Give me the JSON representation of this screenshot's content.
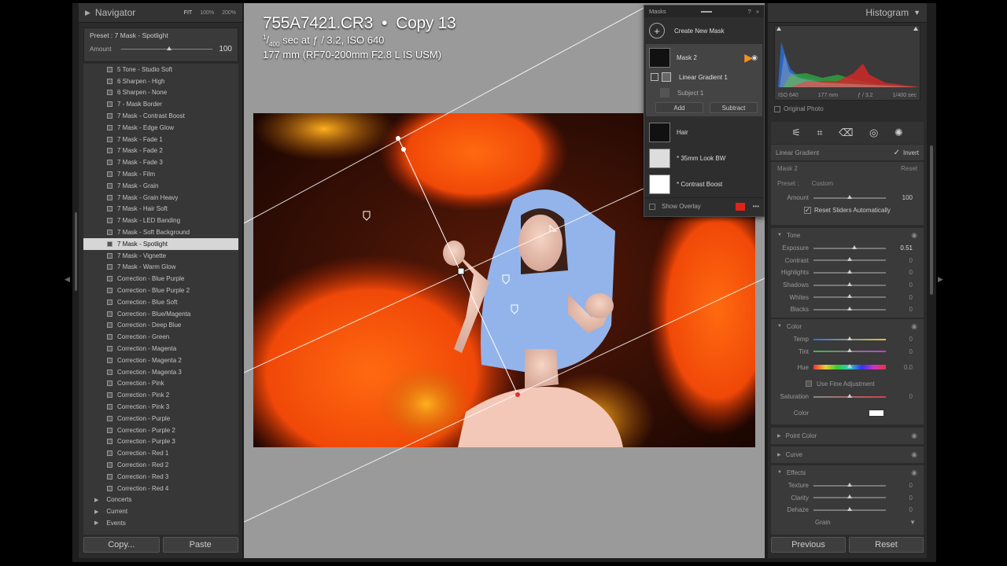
{
  "left": {
    "navigator_title": "Navigator",
    "nav_opts": [
      "FIT",
      "100%",
      "200%"
    ],
    "preset_label": "Preset : 7 Mask - Spotlight",
    "amount_label": "Amount",
    "amount_value": "100",
    "presets": [
      "5 Tone - Studio Soft",
      "6 Sharpen - High",
      "6 Sharpen - None",
      "7 - Mask Border",
      "7 Mask - Contrast Boost",
      "7 Mask - Edge Glow",
      "7 Mask - Fade 1",
      "7 Mask - Fade 2",
      "7 Mask - Fade 3",
      "7 Mask - Film",
      "7 Mask - Grain",
      "7 Mask - Grain Heavy",
      "7 Mask - Hair Soft",
      "7 Mask - LED Banding",
      "7 Mask - Soft Background",
      "7 Mask - Spotlight",
      "7 Mask - Vignette",
      "7 Mask - Warm Glow",
      "Correction - Blue Purple",
      "Correction - Blue Purple 2",
      "Correction - Blue Soft",
      "Correction - Blue/Magenta",
      "Correction - Deep Blue",
      "Correction - Green",
      "Correction - Magenta",
      "Correction - Magenta 2",
      "Correction - Magenta 3",
      "Correction - Pink",
      "Correction - Pink 2",
      "Correction - Pink 3",
      "Correction - Purple",
      "Correction - Purple 2",
      "Correction - Purple 3",
      "Correction - Red 1",
      "Correction - Red 2",
      "Correction - Red 3",
      "Correction - Red 4"
    ],
    "selected_preset": "7 Mask - Spotlight",
    "folders": [
      "Concerts",
      "Current",
      "Events"
    ],
    "copy_label": "Copy...",
    "paste_label": "Paste"
  },
  "center": {
    "filename": "755A7421.CR3",
    "copy_name": "Copy 13",
    "exposure_line": "sec at ƒ / 3.2, ISO 640",
    "shutter_num": "1",
    "shutter_den": "400",
    "lens_line": "177 mm (RF70-200mm F2.8 L IS USM)"
  },
  "masks": {
    "title": "Masks",
    "create_label": "Create New Mask",
    "items": [
      "Mask 2",
      "Linear Gradient 1",
      "Subject 1"
    ],
    "add_label": "Add",
    "subtract_label": "Subtract",
    "others": [
      "Hair",
      "* 35mm Look BW",
      "* Contrast Boost"
    ],
    "show_overlay": "Show Overlay",
    "overlay_color": "#e0231a"
  },
  "right": {
    "histogram_title": "Histogram",
    "histo_info": [
      "ISO 640",
      "177 mm",
      "ƒ / 3.2",
      "1/400 sec"
    ],
    "original_photo": "Original Photo",
    "mask_type": "Linear Gradient",
    "invert_label": "Invert",
    "mask_name": "Mask 2",
    "reset_small": "Reset",
    "preset_label": "Preset :",
    "preset_value": "Custom",
    "amount_label": "Amount",
    "amount_value": "100",
    "reset_auto": "Reset Sliders Automatically",
    "tone_title": "Tone",
    "tone": [
      {
        "label": "Exposure",
        "value": "0.51",
        "pos": 0.56
      },
      {
        "label": "Contrast",
        "value": "0",
        "pos": 0.5
      },
      {
        "label": "Highlights",
        "value": "0",
        "pos": 0.5
      },
      {
        "label": "Shadows",
        "value": "0",
        "pos": 0.5
      },
      {
        "label": "Whites",
        "value": "0",
        "pos": 0.5
      },
      {
        "label": "Blacks",
        "value": "0",
        "pos": 0.5
      }
    ],
    "color_title": "Color",
    "color": [
      {
        "label": "Temp",
        "value": "0",
        "pos": 0.5
      },
      {
        "label": "Tint",
        "value": "0",
        "pos": 0.5
      },
      {
        "label": "Hue",
        "value": "0.0",
        "pos": 0.5
      }
    ],
    "fine_adjust": "Use Fine Adjustment",
    "saturation": {
      "label": "Saturation",
      "value": "0",
      "pos": 0.5
    },
    "color_label": "Color",
    "point_color": "Point Color",
    "curve": "Curve",
    "effects_title": "Effects",
    "effects": [
      {
        "label": "Texture",
        "value": "0",
        "pos": 0.5
      },
      {
        "label": "Clarity",
        "value": "0",
        "pos": 0.5
      },
      {
        "label": "Dehaze",
        "value": "0",
        "pos": 0.5
      }
    ],
    "grain": "Grain",
    "previous_label": "Previous",
    "reset_label": "Reset"
  }
}
